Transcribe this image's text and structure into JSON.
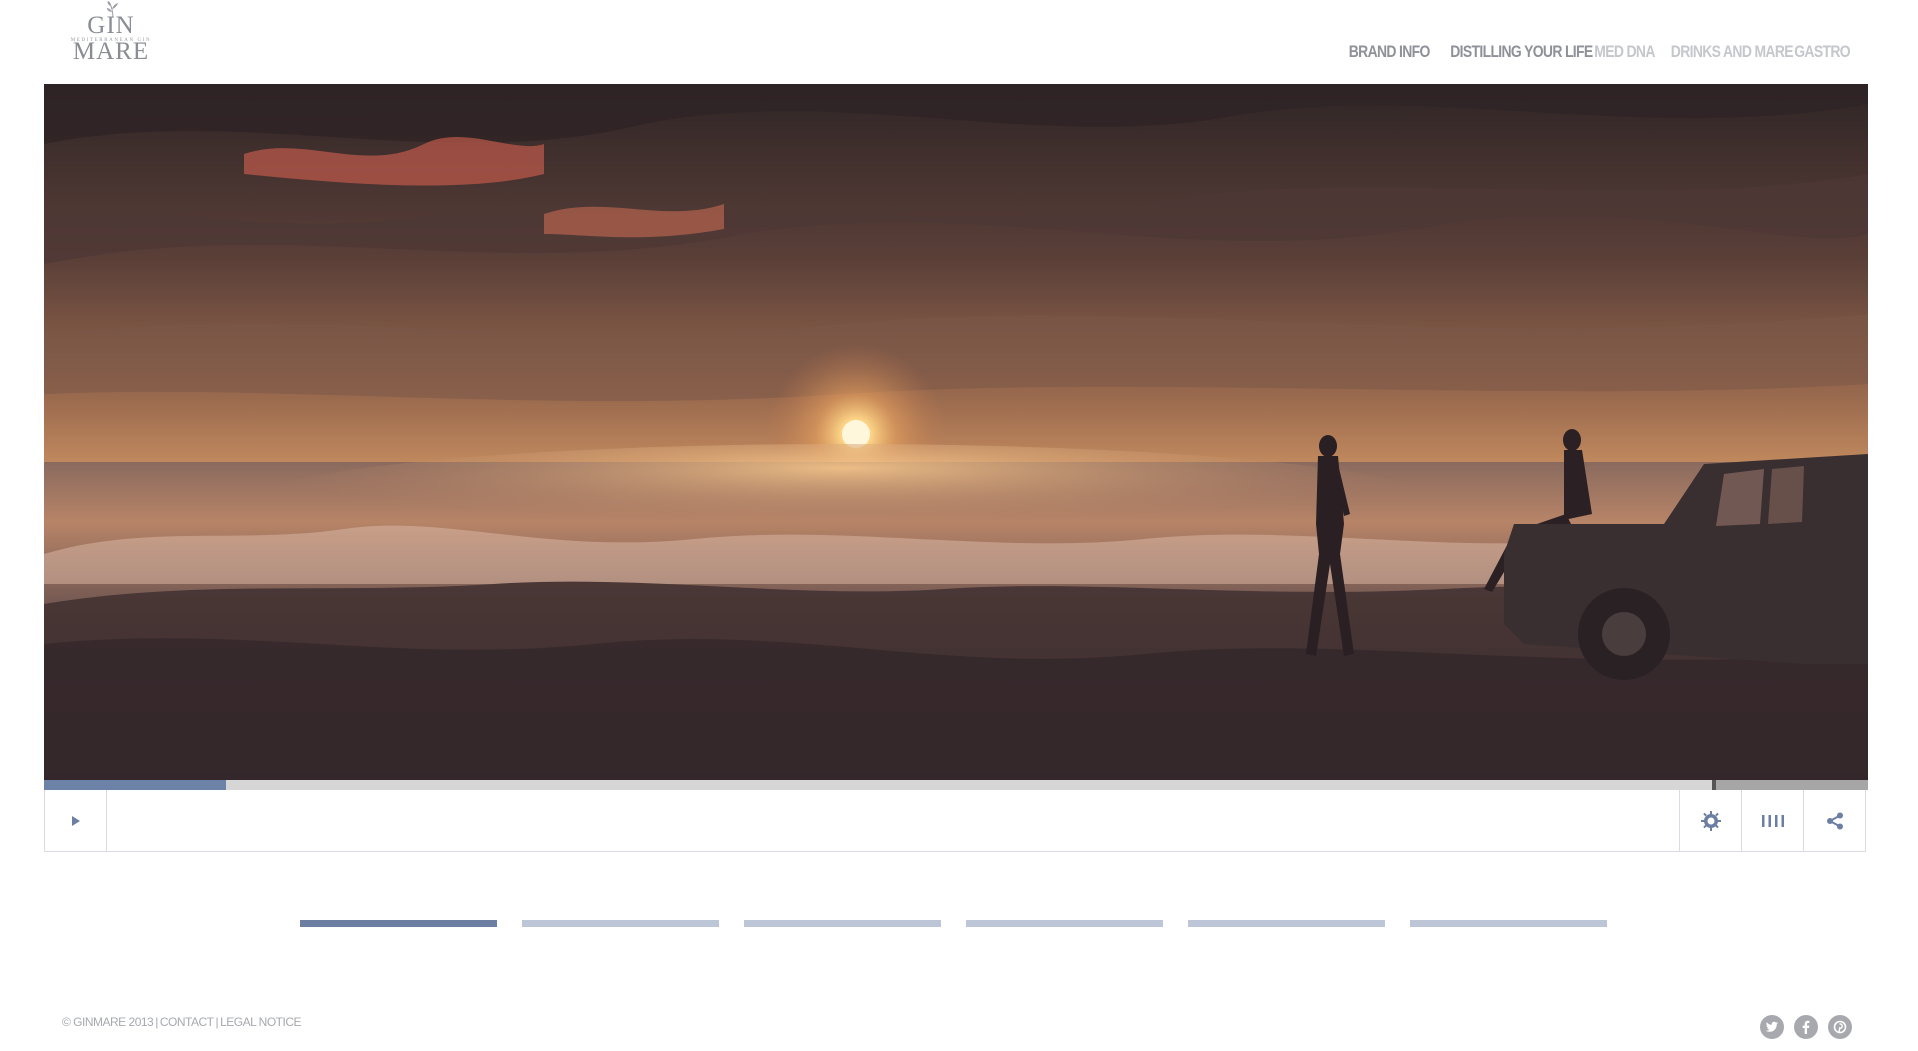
{
  "brand": {
    "name": "GIN MARE",
    "tagline": "MEDITERRANEAN GIN"
  },
  "nav": {
    "items": [
      {
        "label": "BRAND INFO",
        "active": true
      },
      {
        "label": "DISTILLING YOUR LIFE",
        "active": true
      },
      {
        "label": "MED DNA",
        "active": false
      },
      {
        "label": "DRINKS AND MARE",
        "active": false
      },
      {
        "label": "GASTRO",
        "active": false
      }
    ]
  },
  "video": {
    "scene": "sunset-beach-video-frame",
    "progress_played": 0.1,
    "progress_buffered_from": 0.914
  },
  "controls": {
    "play_icon": "play-icon",
    "settings_icon": "gear-icon",
    "chapters_icon": "chapters-icon",
    "share_icon": "share-icon"
  },
  "slides": {
    "count": 6,
    "active_index": 0
  },
  "footer": {
    "copyright": "© GINMARE 2013",
    "contact": "CONTACT",
    "legal": "LEGAL NOTICE",
    "separator": "|"
  },
  "social": {
    "icons": [
      "twitter-icon",
      "facebook-icon",
      "pinterest-icon"
    ]
  },
  "colors": {
    "accent": "#6c7fa3",
    "nav_active": "#8e9198",
    "nav_inactive": "#c5c7cc",
    "indicator_inactive": "#bcc6d6",
    "social": "#a7a9ae"
  }
}
